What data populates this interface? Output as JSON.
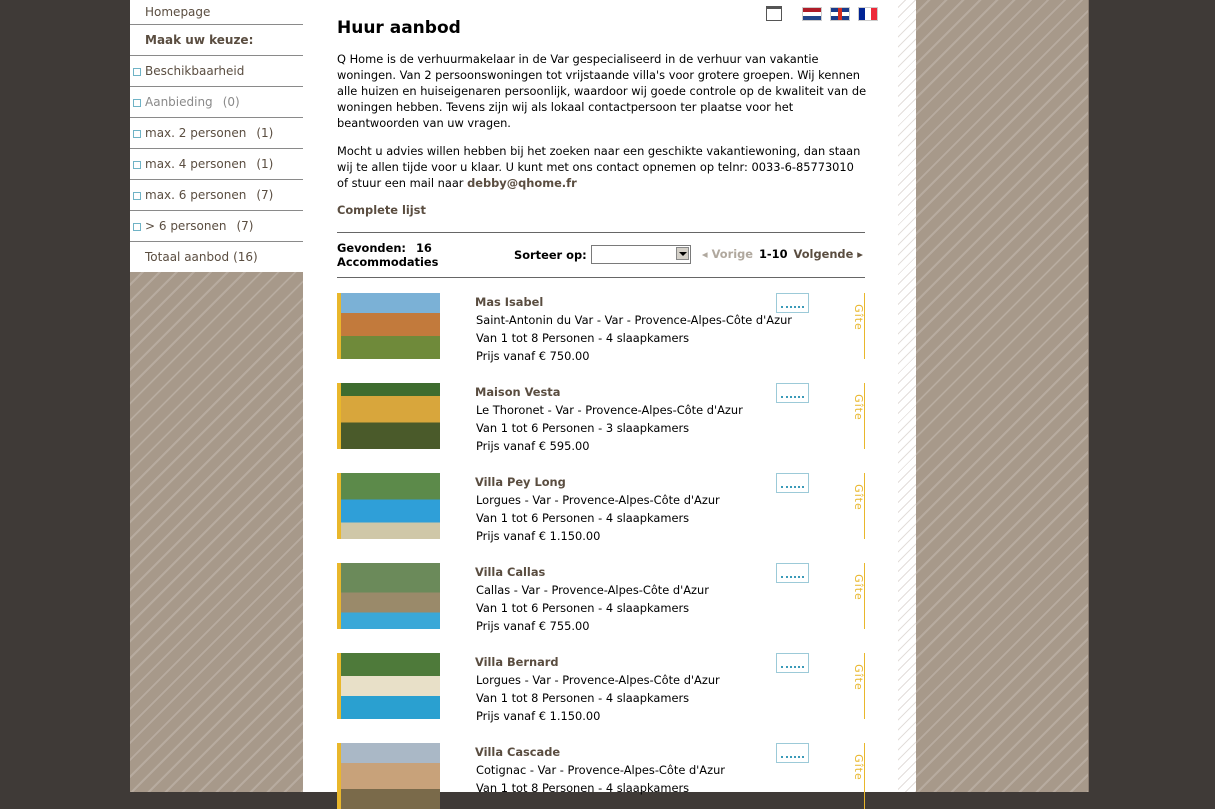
{
  "menu": {
    "home": "Homepage",
    "heading": "Maak uw keuze:",
    "items": [
      {
        "label": "Beschikbaarheid",
        "count": ""
      },
      {
        "label": "Aanbieding",
        "count": "(0)"
      },
      {
        "label": "max. 2 personen",
        "count": "(1)"
      },
      {
        "label": "max. 4 personen",
        "count": "(1)"
      },
      {
        "label": "max. 6 personen",
        "count": "(7)"
      },
      {
        "label": "> 6 personen",
        "count": "(7)"
      }
    ],
    "total": {
      "label": "Totaal aanbod",
      "count": "(16)"
    }
  },
  "page": {
    "title": "Huur aanbod",
    "intro1": "Q Home is de verhuurmakelaar in de Var gespecialiseerd in de verhuur van vakantie woningen. Van 2 persoonswoningen tot vrijstaande villa's voor grotere groepen. Wij kennen alle huizen en huiseigenaren persoonlijk, waardoor wij goede controle op de kwaliteit van de woningen hebben. Tevens zijn wij als lokaal contactpersoon ter plaatse voor het beantwoorden van uw vragen.",
    "intro2": "Mocht u advies willen hebben bij het zoeken naar een geschikte vakantiewoning, dan staan wij te allen tijde voor u klaar. U kunt met ons contact opnemen op telnr: 0033-6-85773010 of stuur een mail naar",
    "email": "debby@qhome.fr",
    "complete_list": "Complete lijst"
  },
  "results": {
    "found_label": "Gevonden:",
    "found_count": "16",
    "found_unit": "Accommodaties",
    "sort_label": "Sorteer op:",
    "sort_value": "",
    "prev": "Vorige",
    "range": "1-10",
    "next": "Volgende"
  },
  "listings": [
    {
      "name": "Mas Isabel",
      "location": "Saint-Antonin du Var - Var - Provence-Alpes-Côte d'Azur",
      "persons": "Van 1 tot 8 Personen - 4 slaapkamers",
      "price": "Prijs vanaf € 750.00",
      "type": "Gîte"
    },
    {
      "name": "Maison Vesta",
      "location": "Le Thoronet - Var - Provence-Alpes-Côte d'Azur",
      "persons": "Van 1 tot 6 Personen - 3 slaapkamers",
      "price": "Prijs vanaf € 595.00",
      "type": "Gîte"
    },
    {
      "name": "Villa Pey Long",
      "location": "Lorgues - Var - Provence-Alpes-Côte d'Azur",
      "persons": "Van 1 tot 6 Personen - 4 slaapkamers",
      "price": "Prijs vanaf € 1.150.00",
      "type": "Gîte"
    },
    {
      "name": "Villa Callas",
      "location": "Callas - Var - Provence-Alpes-Côte d'Azur",
      "persons": "Van 1 tot 6 Personen - 4 slaapkamers",
      "price": "Prijs vanaf € 755.00",
      "type": "Gîte"
    },
    {
      "name": "Villa Bernard",
      "location": "Lorgues - Var - Provence-Alpes-Côte d'Azur",
      "persons": "Van 1 tot 8 Personen - 4 slaapkamers",
      "price": "Prijs vanaf € 1.150.00",
      "type": "Gîte"
    },
    {
      "name": "Villa Cascade",
      "location": "Cotignac - Var - Provence-Alpes-Côte d'Azur",
      "persons": "Van 1 tot 8 Personen - 4 slaapkamers",
      "price": "",
      "type": "Gîte"
    }
  ],
  "icons": {
    "print": "print-icon",
    "flags": [
      "flag-nl-icon",
      "flag-uk-icon",
      "flag-fr-icon"
    ],
    "pool": "pool-icon"
  },
  "colors": {
    "accent": "#e9b72b",
    "brown_text": "#5a4d40",
    "menu_bullet": "#6fb3c6",
    "background": "#3f3a37"
  }
}
